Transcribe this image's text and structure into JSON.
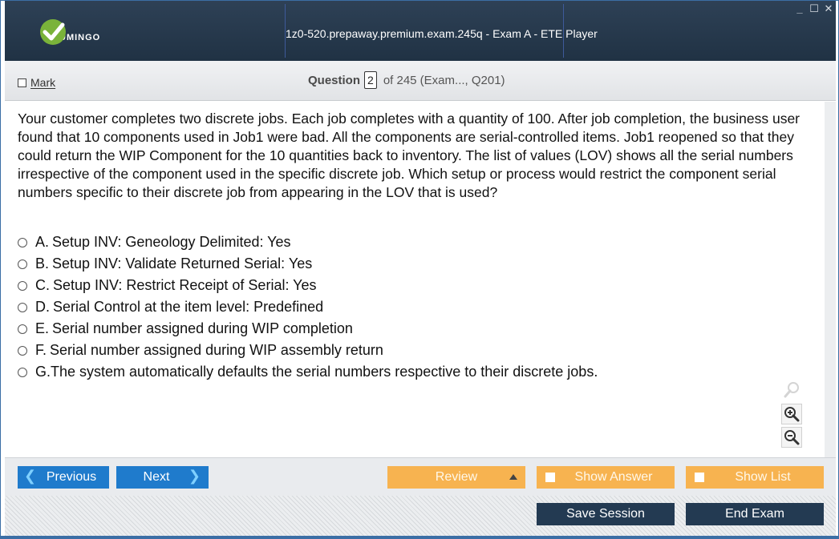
{
  "app": {
    "logo_text": "UMINGO",
    "window_title": "1z0-520.prepaway.premium.exam.245q - Exam A - ETE Player",
    "controls": {
      "minimize": "_",
      "maximize": "☐",
      "close": "✕"
    }
  },
  "header": {
    "mark_label": "Mark",
    "question_label": "Question",
    "question_number": "2",
    "question_of": "of 245 (Exam..., Q201)"
  },
  "question": {
    "text": "Your customer completes two discrete jobs. Each job completes with a quantity of 100. After job completion, the business user found that 10 components used in Job1 were bad. All the components are serial-controlled items. Job1 reopened so that they could return the WIP Component for the 10 quantities back to inventory. The list of values (LOV) shows all the serial numbers irrespective of the component used in the specific discrete job. Which setup or process would restrict the component serial numbers specific to their discrete job from appearing in the LOV that is used?",
    "options": [
      {
        "letter": "A.",
        "text": "Setup INV: Geneology Delimited: Yes"
      },
      {
        "letter": "B.",
        "text": "Setup INV: Validate Returned Serial: Yes"
      },
      {
        "letter": "C.",
        "text": "Setup INV: Restrict Receipt of Serial: Yes"
      },
      {
        "letter": "D.",
        "text": "Serial Control at the item level: Predefined"
      },
      {
        "letter": "E.",
        "text": "Serial number assigned during WIP completion"
      },
      {
        "letter": "F.",
        "text": "Serial number assigned during WIP assembly return"
      },
      {
        "letter": "G.",
        "text": "The system automatically defaults the serial numbers respective to their discrete jobs."
      }
    ]
  },
  "nav": {
    "previous_label": "Previous",
    "next_label": "Next",
    "review_label": "Review",
    "show_answer_label": "Show Answer",
    "show_list_label": "Show List",
    "save_session_label": "Save Session",
    "end_exam_label": "End Exam"
  },
  "colors": {
    "titlebar": "#233446",
    "nav_blue": "#1f7bcc",
    "nav_orange": "#f7b350",
    "dark_button": "#233a52",
    "logo_green": "#7ab33a"
  },
  "icons": [
    "check-logo-icon",
    "search-icon",
    "zoom-in-icon",
    "zoom-out-icon",
    "chevron-left-icon",
    "chevron-right-icon",
    "caret-up-icon"
  ]
}
